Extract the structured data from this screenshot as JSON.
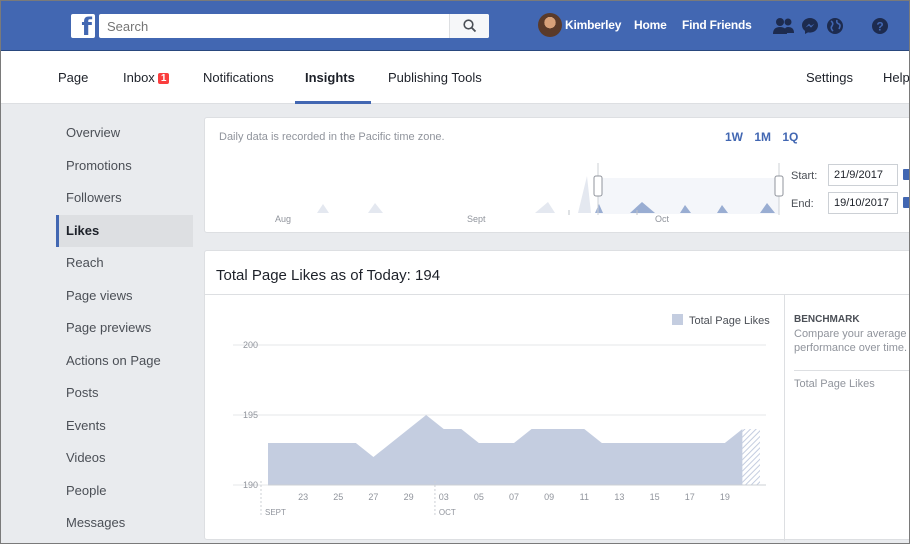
{
  "topbar": {
    "search_placeholder": "Search",
    "user_name": "Kimberley",
    "home": "Home",
    "find_friends": "Find Friends",
    "icons": [
      "facebook-logo-icon",
      "search-icon",
      "friend-requests-icon",
      "messenger-icon",
      "notifications-globe-icon",
      "help-icon"
    ]
  },
  "nav": {
    "page": "Page",
    "inbox": "Inbox",
    "inbox_badge": "1",
    "notifications": "Notifications",
    "insights": "Insights",
    "publishing_tools": "Publishing Tools",
    "settings": "Settings",
    "help": "Help",
    "active": "Insights"
  },
  "sidebar": {
    "items": [
      "Overview",
      "Promotions",
      "Followers",
      "Likes",
      "Reach",
      "Page views",
      "Page previews",
      "Actions on Page",
      "Posts",
      "Events",
      "Videos",
      "People",
      "Messages"
    ],
    "active": "Likes"
  },
  "timeline": {
    "note": "Daily data is recorded in the Pacific time zone.",
    "ranges": [
      "1W",
      "1M",
      "1Q"
    ],
    "months": [
      "Aug",
      "Sept",
      "Oct"
    ],
    "start_label": "Start:",
    "start_value": "21/9/2017",
    "end_label": "End:",
    "end_value": "19/10/2017"
  },
  "likes_card": {
    "title": "Total Page Likes as of Today: 194",
    "legend": "Total Page Likes",
    "benchmark_title": "BENCHMARK",
    "benchmark_desc": "Compare your average performance over time.",
    "benchmark_metric": "Total Page Likes"
  },
  "colors": {
    "brand": "#4267b2",
    "series_fill": "#c4cde0",
    "badge": "#fa3e3e"
  },
  "chart_data": {
    "type": "area",
    "title": "Total Page Likes as of Today: 194",
    "y_ticks": [
      190,
      195,
      200
    ],
    "ylim": [
      190,
      200
    ],
    "x_tick_labels": [
      "23",
      "25",
      "27",
      "29",
      "03",
      "05",
      "07",
      "09",
      "11",
      "13",
      "15",
      "17",
      "19"
    ],
    "month_labels": [
      "SEPT",
      "OCT"
    ],
    "series": [
      {
        "name": "Total Page Likes",
        "x": [
          "2017-09-21",
          "2017-09-22",
          "2017-09-23",
          "2017-09-24",
          "2017-09-25",
          "2017-09-26",
          "2017-09-27",
          "2017-09-28",
          "2017-09-29",
          "2017-09-30",
          "2017-10-01",
          "2017-10-02",
          "2017-10-03",
          "2017-10-04",
          "2017-10-05",
          "2017-10-06",
          "2017-10-07",
          "2017-10-08",
          "2017-10-09",
          "2017-10-10",
          "2017-10-11",
          "2017-10-12",
          "2017-10-13",
          "2017-10-14",
          "2017-10-15",
          "2017-10-16",
          "2017-10-17",
          "2017-10-18",
          "2017-10-19"
        ],
        "values": [
          193,
          193,
          193,
          193,
          193,
          193,
          192,
          193,
          194,
          195,
          194,
          194,
          193,
          193,
          193,
          194,
          194,
          194,
          194,
          193,
          193,
          193,
          193,
          193,
          193,
          193,
          193,
          194,
          194
        ]
      }
    ]
  }
}
